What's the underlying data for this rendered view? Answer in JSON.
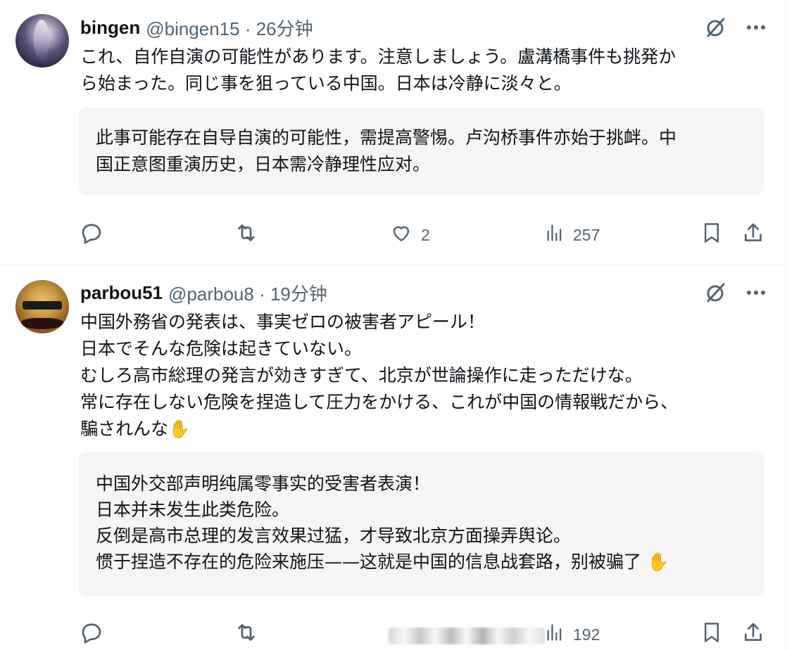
{
  "posts": [
    {
      "name": "bingen",
      "handle_time": "@bingen15 · 26分钟",
      "text": "これ、自作自演の可能性があります。注意しましょう。盧溝橋事件も挑発か\nら始まった。同じ事を狙っている中国。日本は冷静に淡々と。",
      "translation": "此事可能存在自导自演的可能性，需提高警惕。卢沟桥事件亦始于挑衅。中\n国正意图重演历史，日本需冷静理性应对。",
      "likes": "2",
      "views": "257"
    },
    {
      "name": "parbou51",
      "handle_time": "@parbou8 · 19分钟",
      "text": "中国外務省の発表は、事実ゼロの被害者アピール！\n日本でそんな危険は起きていない。\nむしろ高市総理の発言が効きすぎて、北京が世論操作に走っただけな。\n常に存在しない危険を捏造して圧力をかける、これが中国の情報戦だから、\n騙されんな✋",
      "translation": "中国外交部声明纯属零事实的受害者表演！\n日本并未发生此类危险。\n反倒是高市总理的发言效果过猛，才导致北京方面操弄舆论。\n惯于捏造不存在的危险来施压——这就是中国的信息战套路，别被骗了 ✋",
      "likes": "",
      "views": "192"
    }
  ],
  "icons": {
    "grok": "grok-slash-icon",
    "more": "more-dots-icon",
    "reply": "reply-bubble-icon",
    "repost": "repost-arrows-icon",
    "like": "heart-icon",
    "views": "views-bars-icon",
    "bookmark": "bookmark-icon",
    "share": "share-icon"
  },
  "colors": {
    "text": "#0f1419",
    "muted": "#536471",
    "translation_bg": "#f7f4f4",
    "divider": "#eff3f4"
  }
}
